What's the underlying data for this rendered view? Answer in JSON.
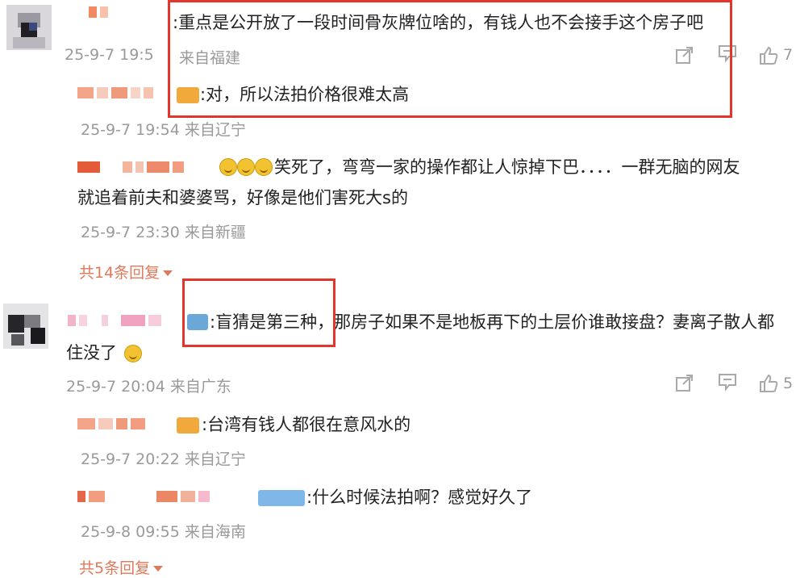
{
  "comments": [
    {
      "text": ":重点是公开放了一段时间骨灰牌位啥的，有钱人也不会接手这个房子吧",
      "meta": "25-9-7 19:5",
      "location": "来自福建",
      "like_count": "7",
      "replies": [
        {
          "text": ":对，所以法拍价格很难太高",
          "meta": "25-9-7 19:54 来自辽宁"
        },
        {
          "text": "笑死了，弯弯一家的操作都让人惊掉下巴．．．．一群无脑的网友",
          "text2": "就追着前夫和婆婆骂，好像是他们害死大s的",
          "meta": "25-9-7 23:30 来自新疆"
        }
      ],
      "more": "共14条回复"
    },
    {
      "text": ":盲猜是第三种，那房子如果不是地板再下的土层价谁敢接盘？妻离子散人都",
      "text2": "住没了",
      "meta": "25-9-7 20:04 来自广东",
      "like_count": "5",
      "replies": [
        {
          "text": ":台湾有钱人都很在意风水的",
          "meta": "25-9-7 20:22 来自辽宁"
        },
        {
          "text": ":什么时候法拍啊？感觉好久了",
          "meta": "25-9-8 09:55 来自海南"
        }
      ],
      "more": "共5条回复"
    }
  ],
  "badges": {
    "b1": "",
    "b2": "",
    "b3": "",
    "b4": ""
  },
  "icons": [
    "share-icon",
    "comment-icon",
    "like-icon"
  ],
  "colors": {
    "highlight": "#e2352b",
    "meta": "#9a9a9a",
    "more": "#e0785a"
  }
}
